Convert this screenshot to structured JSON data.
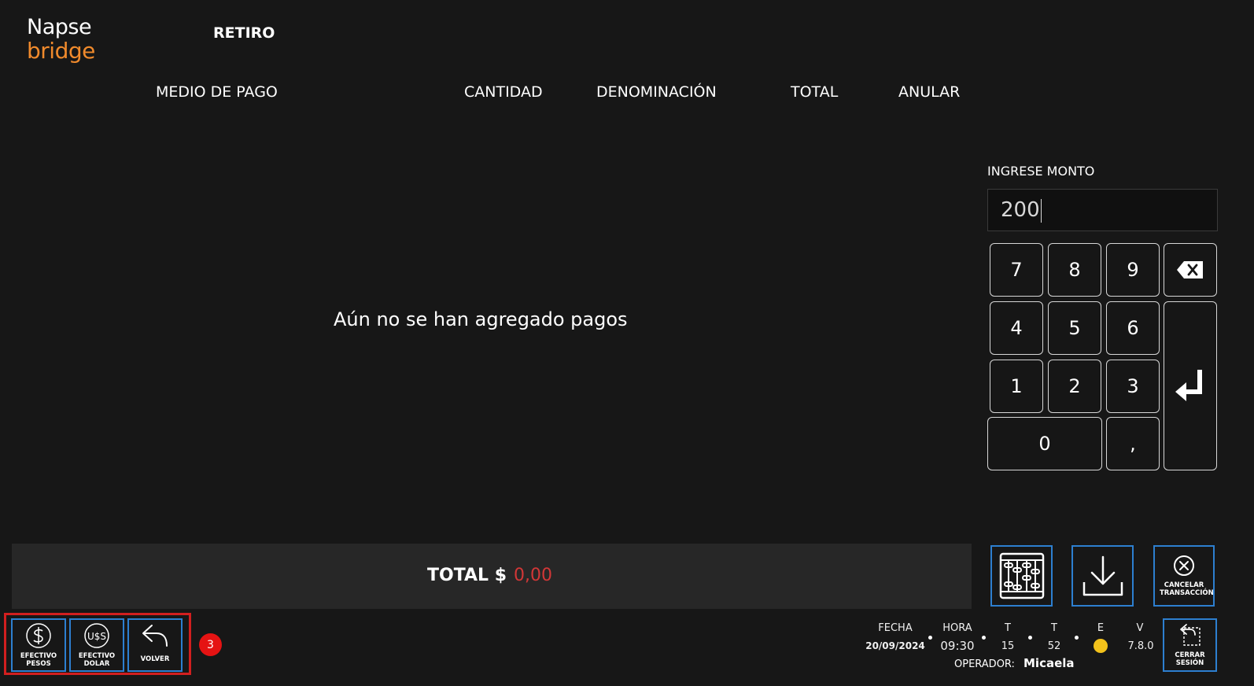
{
  "logo": {
    "line1": "Napse",
    "line2": "bridge"
  },
  "title": "RETIRO",
  "columns": [
    "MEDIO DE PAGO",
    "CANTIDAD",
    "DENOMINACIÓN",
    "TOTAL",
    "ANULAR"
  ],
  "empty_message": "Aún no se han agregado pagos",
  "keypad": {
    "label": "INGRESE MONTO",
    "value": "200",
    "keys": [
      "7",
      "8",
      "9",
      "4",
      "5",
      "6",
      "1",
      "2",
      "3",
      "0",
      ","
    ],
    "backspace_icon": "backspace-icon",
    "enter_icon": "enter-icon"
  },
  "total": {
    "label": "TOTAL $",
    "value": "0,00",
    "value_color": "#d23737"
  },
  "actions": {
    "abacus_icon": "abacus-icon",
    "download_icon": "download-icon",
    "cancel_label": "CANCELAR TRANSACCIÓN"
  },
  "shortcuts": [
    {
      "label": "EFECTIVO PESOS",
      "icon": "dollar-icon"
    },
    {
      "label": "EFECTIVO DOLAR",
      "icon": "usd-icon"
    },
    {
      "label": "VOLVER",
      "icon": "back-arrow-icon"
    }
  ],
  "shortcut_badge": "3",
  "status": {
    "fecha_label": "FECHA",
    "fecha_value": "20/09/2024",
    "hora_label": "HORA",
    "hora_value": "09:30",
    "t1_label": "T",
    "t1_value": "15",
    "t2_label": "T",
    "t2_value": "52",
    "e_label": "E",
    "e_color": "#f3c21b",
    "v_label": "V",
    "v_value": "7.8.0",
    "operador_label": "OPERADOR:",
    "operador_value": "Micaela"
  },
  "logout_label": "CERRAR SESIÓN",
  "colors": {
    "accent_border": "#2d7fd0",
    "logo_orange": "#f08a2c",
    "highlight_red": "#d21f1f"
  }
}
